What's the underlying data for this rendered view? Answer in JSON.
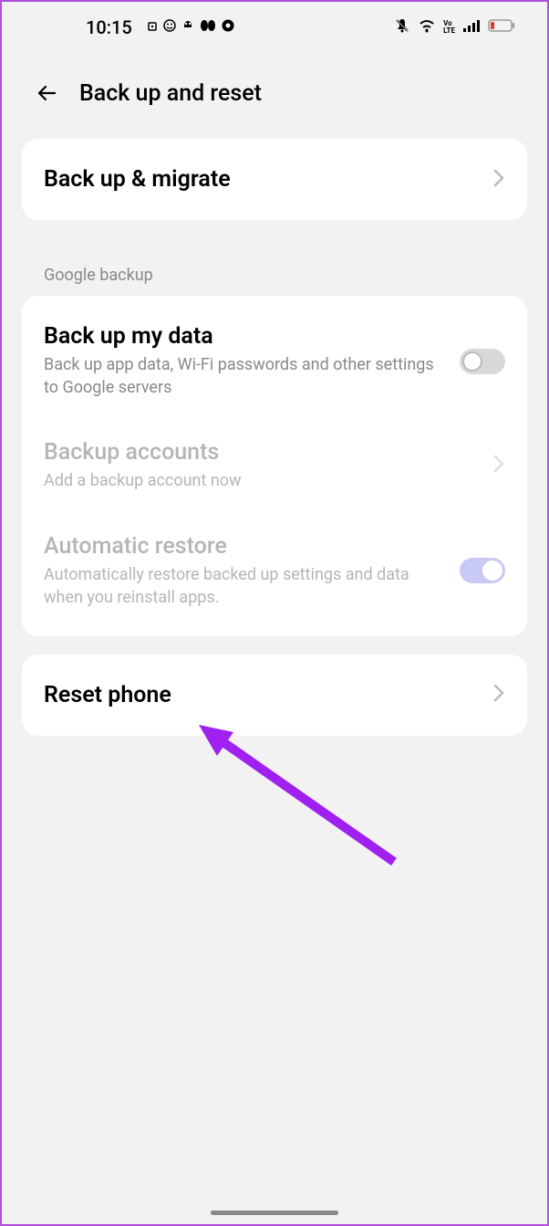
{
  "status": {
    "time": "10:15"
  },
  "header": {
    "title": "Back up and reset"
  },
  "top_card": {
    "title": "Back up & migrate"
  },
  "section_label": "Google backup",
  "google_backup": {
    "backup_my_data": {
      "title": "Back up my data",
      "subtitle": "Back up app data, Wi-Fi passwords and other settings to Google servers"
    },
    "backup_accounts": {
      "title": "Backup accounts",
      "subtitle": "Add a backup account now"
    },
    "automatic_restore": {
      "title": "Automatic restore",
      "subtitle": "Automatically restore backed up settings and data when you reinstall apps."
    }
  },
  "reset_card": {
    "title": "Reset phone"
  }
}
